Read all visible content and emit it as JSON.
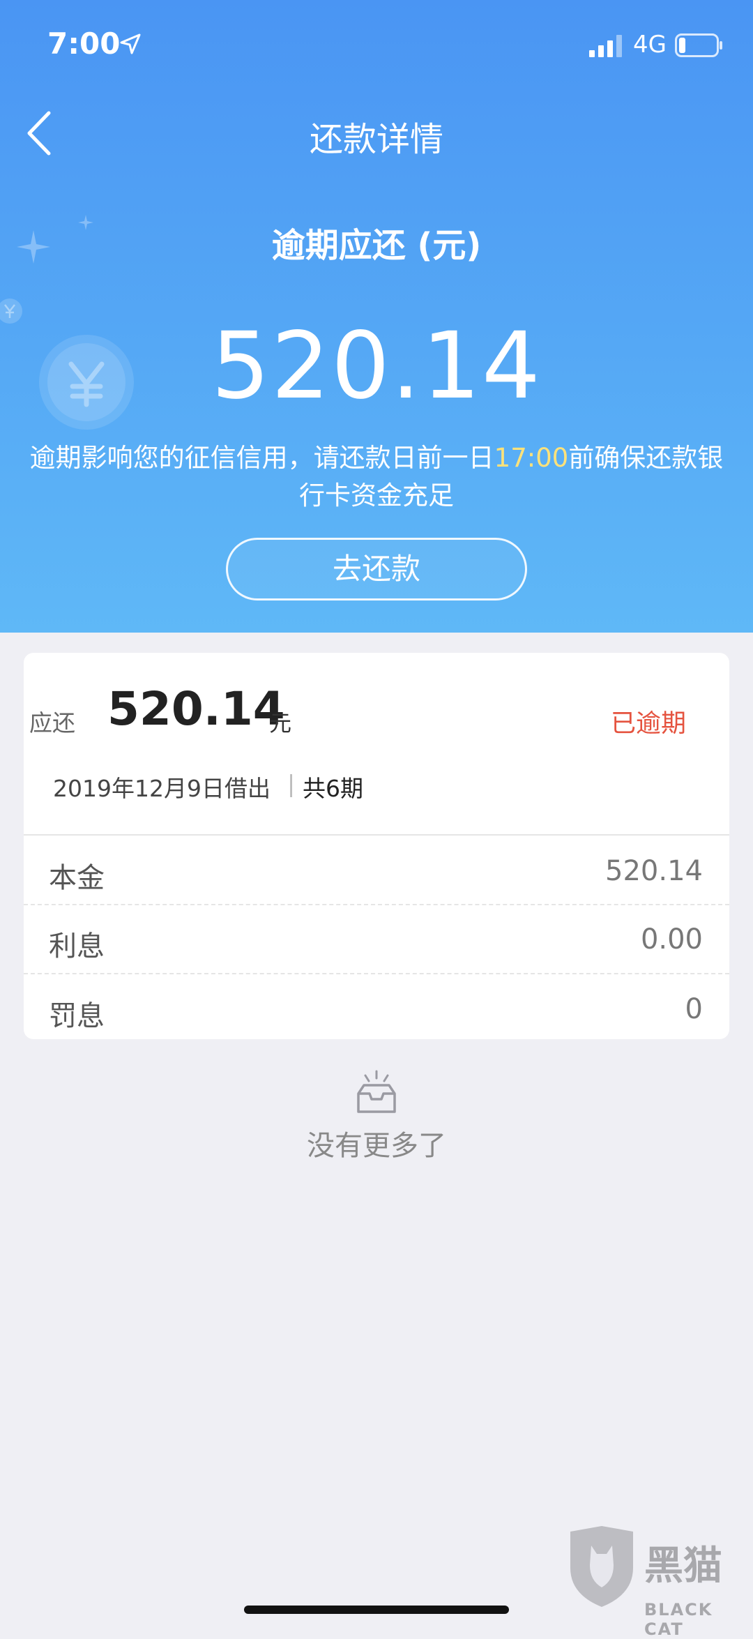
{
  "status_bar": {
    "time": "7:00",
    "network": "4G"
  },
  "nav": {
    "title": "还款详情"
  },
  "hero": {
    "label": "逾期应还 (元)",
    "amount": "520.14",
    "notice_before": "逾期影响您的征信信用，请还款日前一日",
    "notice_time": "17:00",
    "notice_after": "前确保还款银行卡资金充足",
    "button_label": "去还款"
  },
  "card": {
    "due_label": "应还",
    "due_amount": "520.14",
    "due_unit": "元",
    "status": "已逾期",
    "loan_date": "2019年12月9日借出",
    "separator": "|",
    "term_count": "共6期",
    "rows": [
      {
        "label": "本金",
        "value": "520.14"
      },
      {
        "label": "利息",
        "value": "0.00"
      },
      {
        "label": "罚息",
        "value": "0"
      }
    ]
  },
  "footer": {
    "empty_text": "没有更多了"
  },
  "watermark": {
    "brand": "黑猫",
    "sub": "BLACK CAT"
  },
  "colors": {
    "hero_top": "#4a95f3",
    "hero_bottom": "#5fb8f7",
    "overdue": "#e5533f",
    "highlight": "#ffe27a",
    "background": "#efeff4"
  },
  "icons": [
    "location-arrow-icon",
    "signal-icon",
    "battery-icon",
    "back-chevron-icon",
    "yen-coin-icon",
    "sparkle-icon",
    "empty-box-icon",
    "black-cat-logo"
  ]
}
